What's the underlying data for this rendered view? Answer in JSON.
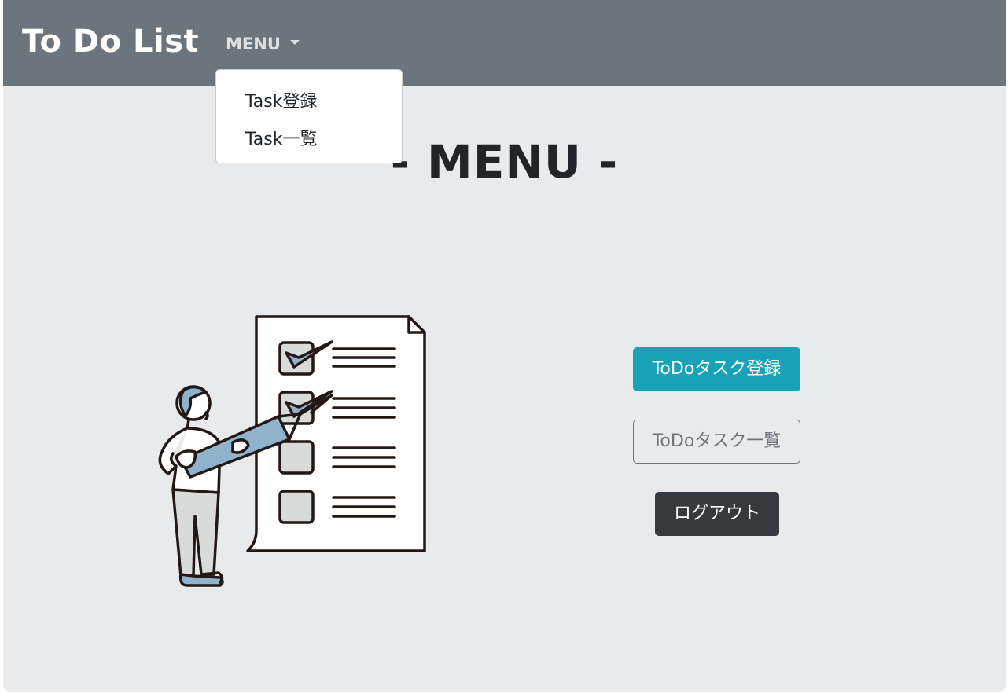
{
  "navbar": {
    "brand": "To Do List",
    "menu_label": "MENU",
    "dropdown_items": [
      {
        "label": "Task登録"
      },
      {
        "label": "Task一覧"
      }
    ]
  },
  "main": {
    "title": "- MENU -",
    "illustration_icon": "checklist-illustration",
    "buttons": {
      "register": "ToDoタスク登録",
      "list": "ToDoタスク一覧",
      "logout": "ログアウト"
    }
  },
  "colors": {
    "navbar": "#6c757d",
    "background": "#e9eaec",
    "info": "#17a2b8",
    "secondary": "#6c757d",
    "dark": "#343a40",
    "illustration_accent": "#8fb3cc"
  }
}
